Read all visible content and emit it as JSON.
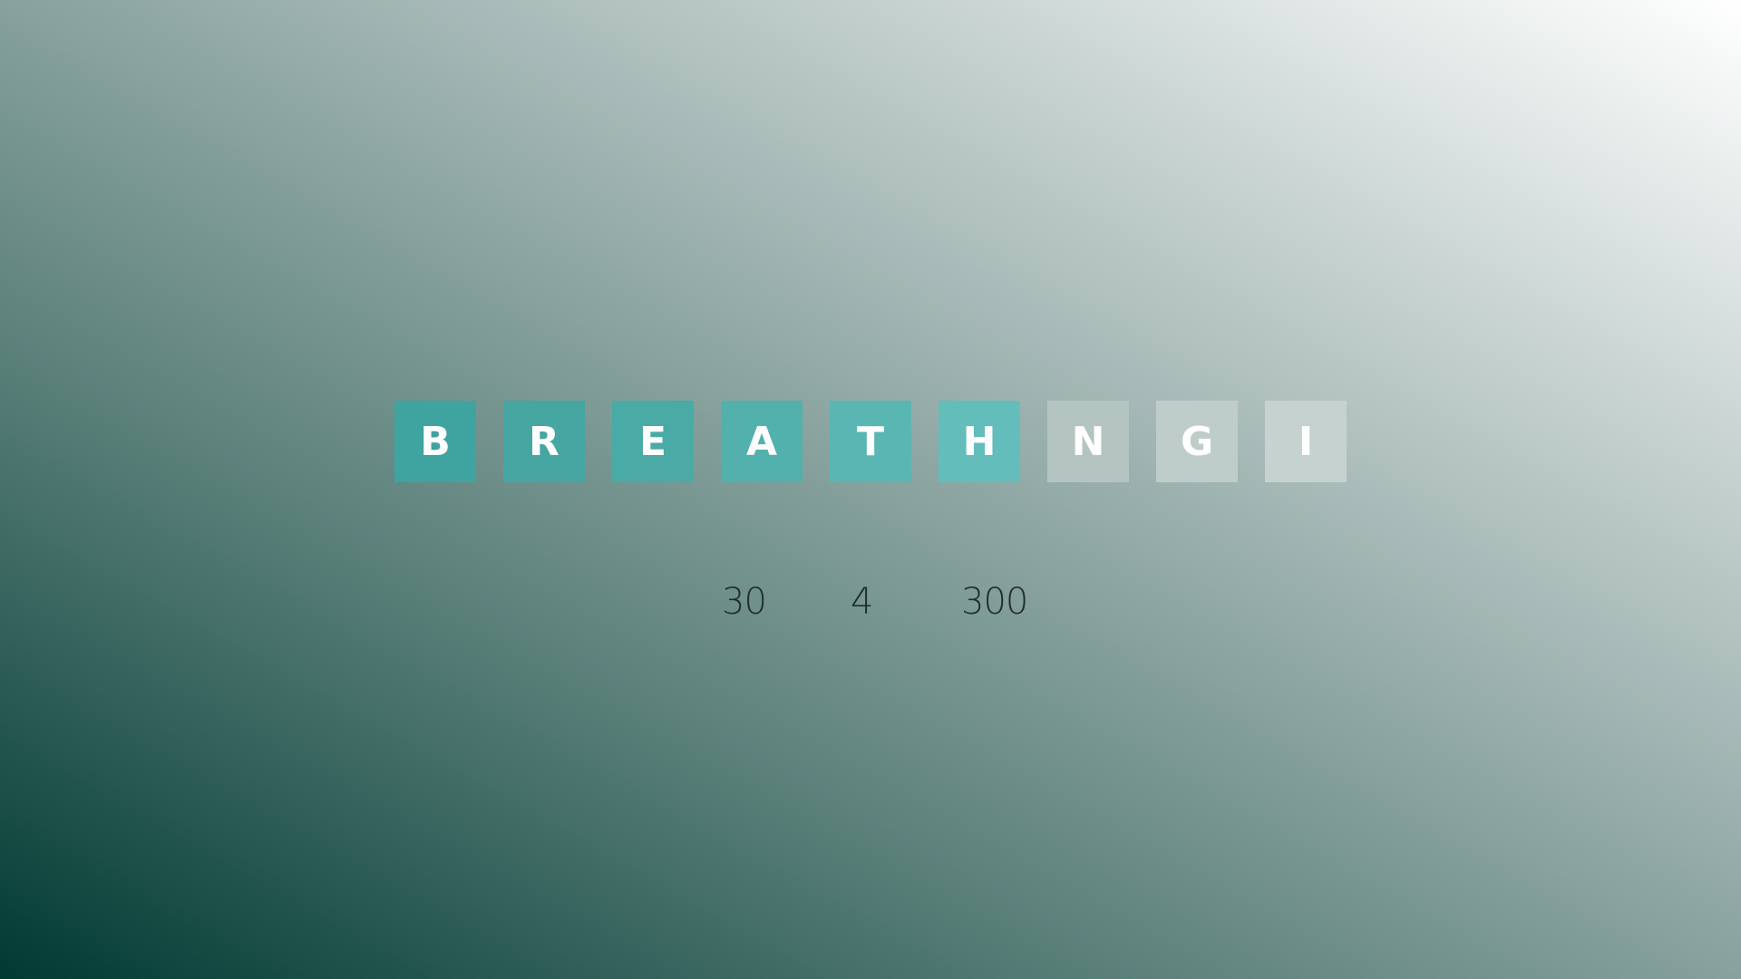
{
  "tiles": [
    {
      "letter": "B",
      "color": "#3fa39f"
    },
    {
      "letter": "R",
      "color": "#45a6a2"
    },
    {
      "letter": "E",
      "color": "#4aaaa6"
    },
    {
      "letter": "A",
      "color": "#52b0ad"
    },
    {
      "letter": "T",
      "color": "#5ab6b3"
    },
    {
      "letter": "H",
      "color": "#63bdbb"
    },
    {
      "letter": "N",
      "color": "#b4c4c1"
    },
    {
      "letter": "G",
      "color": "#bfcdca"
    },
    {
      "letter": "I",
      "color": "#c6d2d0"
    }
  ],
  "stats": [
    "30",
    "4",
    "300"
  ]
}
